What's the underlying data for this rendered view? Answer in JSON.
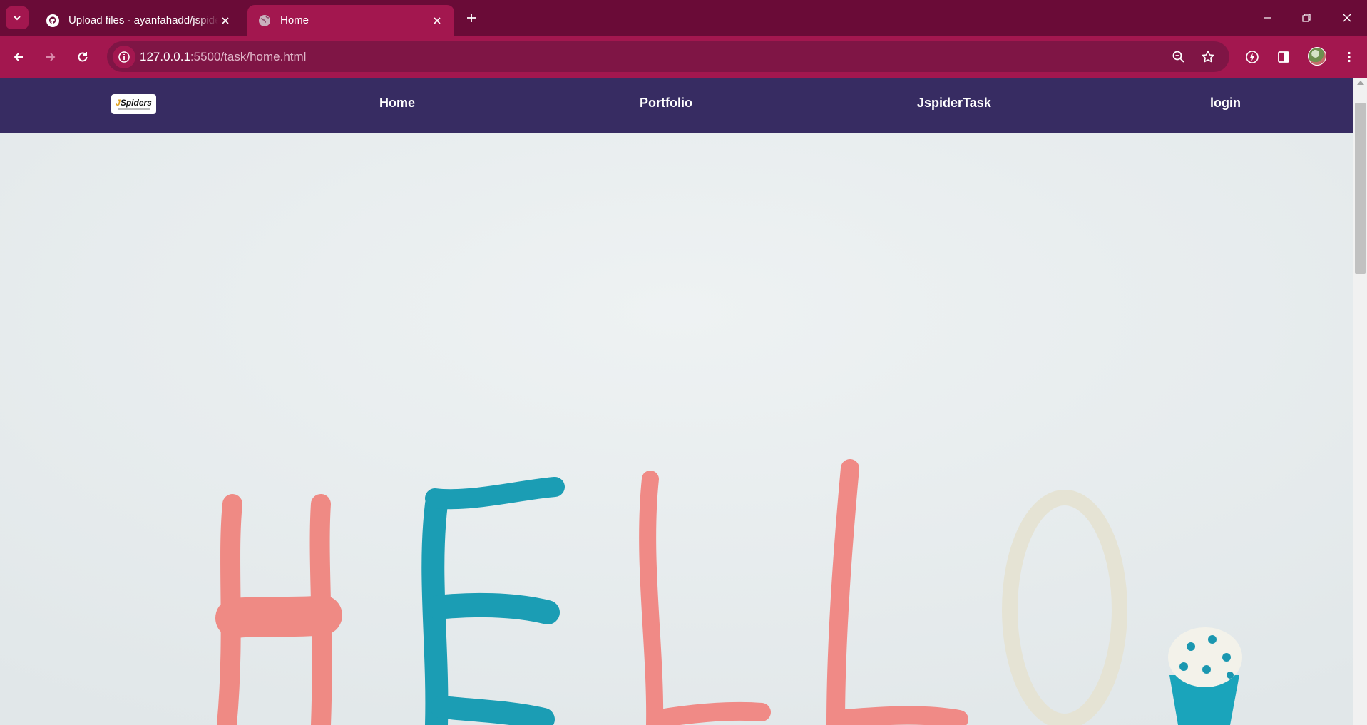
{
  "browser": {
    "tabs": [
      {
        "title": "Upload files · ayanfahadd/jspiders",
        "favicon": "github-icon",
        "active": false
      },
      {
        "title": "Home",
        "favicon": "globe-icon",
        "active": true
      }
    ],
    "url_host": "127.0.0.1",
    "url_path": ":5500/task/home.html",
    "colors": {
      "frame": "#6a0b37",
      "toolbar": "#a3174f",
      "omnibox": "#7f1545"
    }
  },
  "page": {
    "logo": {
      "brand_j": "J",
      "brand_rest": "Spiders"
    },
    "nav": [
      "Home",
      "Portfolio",
      "JspiderTask",
      "login"
    ],
    "hero_image": "HELLO clay letters",
    "colors": {
      "navbar": "#372c62"
    }
  }
}
